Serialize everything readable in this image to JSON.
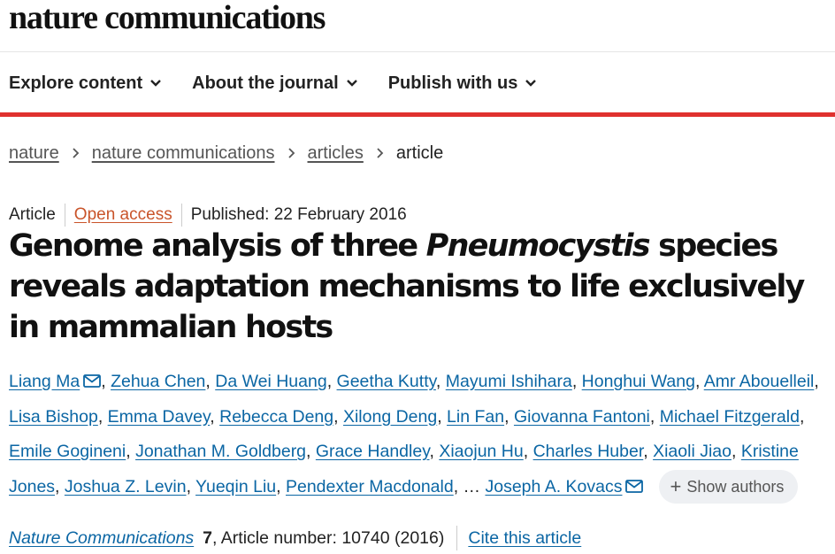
{
  "brand": "nature communications",
  "nav": [
    {
      "label": "Explore content"
    },
    {
      "label": "About the journal"
    },
    {
      "label": "Publish with us"
    }
  ],
  "breadcrumb": [
    "nature",
    "nature communications",
    "articles",
    "article"
  ],
  "meta": {
    "type": "Article",
    "access": "Open access",
    "published": "Published: 22 February 2016"
  },
  "title": {
    "part1": "Genome analysis of three ",
    "italic": "Pneumocystis",
    "part2": " species reveals adaptation mechanisms to life exclusively in mammalian hosts"
  },
  "authors": [
    "Liang Ma",
    "Zehua Chen",
    "Da Wei Huang",
    "Geetha Kutty",
    "Mayumi Ishihara",
    "Honghui Wang",
    "Amr Abouelleil",
    "Lisa Bishop",
    "Emma Davey",
    "Rebecca Deng",
    "Xilong Deng",
    "Lin Fan",
    "Giovanna Fantoni",
    "Michael Fitzgerald",
    "Emile Gogineni",
    "Jonathan M. Goldberg",
    "Grace Handley",
    "Xiaojun Hu",
    "Charles Huber",
    "Xiaoli Jiao",
    "Kristine Jones",
    "Joshua Z. Levin",
    "Yueqin Liu",
    "Pendexter Macdonald"
  ],
  "authors_ellipsis": "…",
  "last_author": "Joseph A. Kovacs",
  "show_authors": "Show authors",
  "citation": {
    "journal": "Nature Communications",
    "volume": "7",
    "rest": ", Article number: 10740 (2016)",
    "cite": "Cite this article"
  },
  "colors": {
    "accent_red": "#e0312e",
    "link_blue": "#0b66a4",
    "open_access_orange": "#c9542a"
  }
}
